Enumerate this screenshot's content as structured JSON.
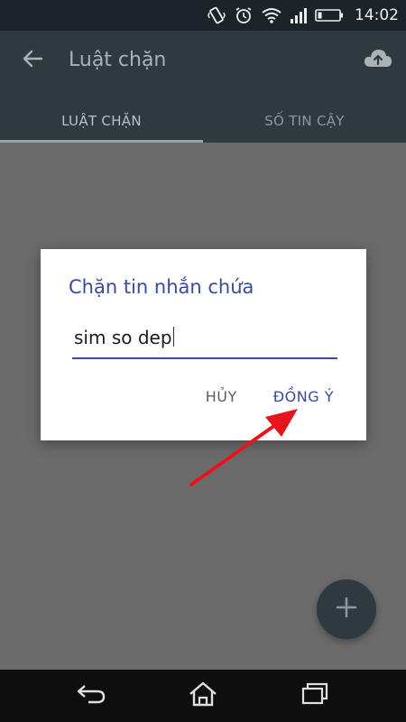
{
  "status_bar": {
    "time": "14:02",
    "icons": [
      "vibrate-icon",
      "alarm-icon",
      "wifi-icon",
      "signal-icon",
      "battery-icon"
    ]
  },
  "app_bar": {
    "title": "Luật chặn",
    "back_icon": "arrow-left-icon",
    "upload_icon": "cloud-upload-icon"
  },
  "tabs": [
    {
      "label": "LUẬT CHẶN",
      "active": true
    },
    {
      "label": "SỐ TIN CẬY",
      "active": false
    }
  ],
  "dialog": {
    "title": "Chặn tin nhắn chứa",
    "input_value": "sim so dep",
    "cancel_label": "HỦY",
    "ok_label": "ĐỒNG Ý"
  },
  "fab": {
    "icon": "plus-icon"
  },
  "nav_bar": {
    "icons": [
      "back-nav-icon",
      "home-nav-icon",
      "recents-nav-icon"
    ]
  },
  "colors": {
    "accent": "#3a4a9c",
    "app_bar": "#2f3a40",
    "annotation_arrow": "#e8141b"
  }
}
